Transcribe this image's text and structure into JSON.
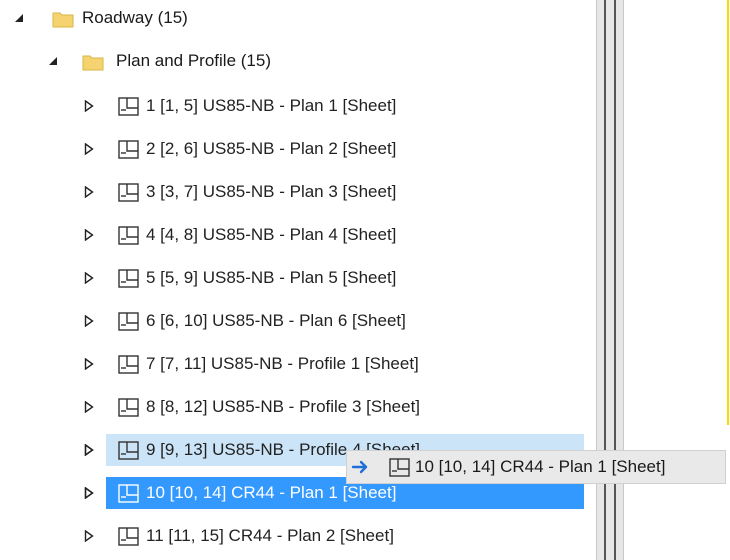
{
  "tree": {
    "root": {
      "label": "Roadway (15)",
      "icon": "folder-icon"
    },
    "group": {
      "label": "Plan and Profile (15)",
      "icon": "folder-icon"
    },
    "sheets": [
      {
        "label": "1 [1, 5] US85-NB - Plan 1 [Sheet]"
      },
      {
        "label": "2 [2, 6] US85-NB - Plan 2 [Sheet]"
      },
      {
        "label": "3 [3, 7] US85-NB - Plan 3 [Sheet]"
      },
      {
        "label": "4 [4, 8] US85-NB - Plan 4 [Sheet]"
      },
      {
        "label": "5 [5, 9] US85-NB - Plan 5 [Sheet]"
      },
      {
        "label": "6 [6, 10] US85-NB - Plan 6 [Sheet]"
      },
      {
        "label": "7 [7, 11] US85-NB - Profile 1 [Sheet]"
      },
      {
        "label": "8 [8, 12] US85-NB - Profile 3 [Sheet]"
      },
      {
        "label": "9 [9, 13] US85-NB - Profile 4 [Sheet]"
      },
      {
        "label": "10 [10, 14] CR44 - Plan 1 [Sheet]"
      },
      {
        "label": "11 [11, 15] CR44 - Plan 2 [Sheet]"
      }
    ]
  },
  "drag": {
    "label": "10 [10, 14] CR44 - Plan 1 [Sheet]",
    "icon": "arrow-right-icon"
  },
  "colors": {
    "selected": "#3399ff",
    "hover": "#cce4f7",
    "folder": "#f5d36f",
    "accent_line": "#ffd700"
  }
}
